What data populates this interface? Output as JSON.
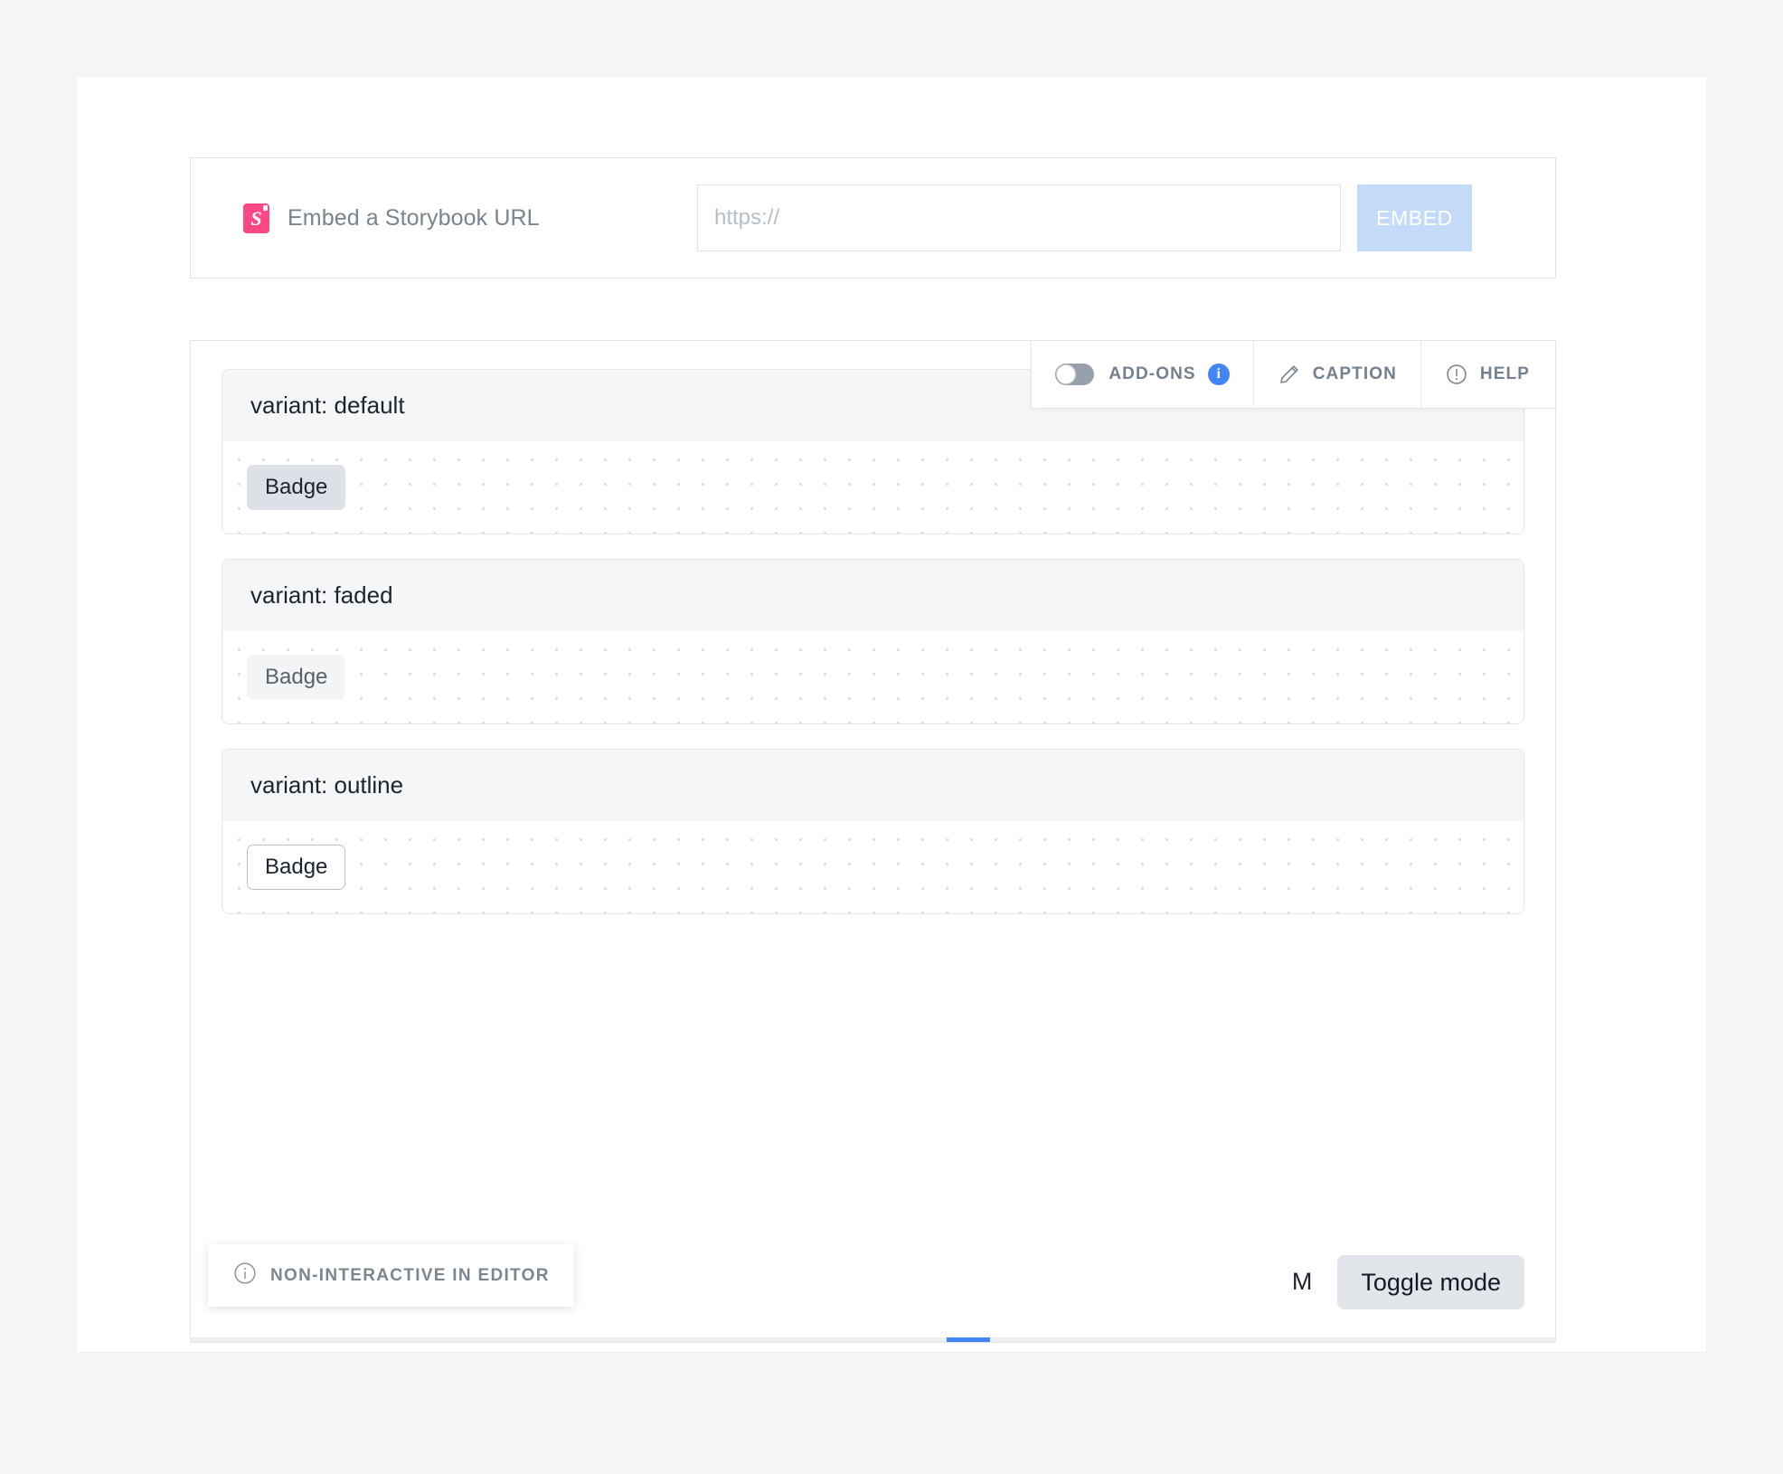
{
  "embed_bar": {
    "logo_icon": "storybook-logo-icon",
    "label": "Embed a Storybook URL",
    "url_value": "",
    "url_placeholder": "https://",
    "embed_button": "EMBED"
  },
  "toolbar": {
    "addons": {
      "label": "ADD-ONS",
      "toggle_state": "off",
      "toggle_icon": "toggle-switch-icon",
      "info_icon": "info-circle-icon",
      "info_color": "#4285f4"
    },
    "caption": {
      "label": "CAPTION",
      "icon": "pencil-icon"
    },
    "help": {
      "label": "HELP",
      "icon": "exclamation-circle-icon"
    }
  },
  "variants": [
    {
      "title": "variant: default",
      "badge_label": "Badge",
      "style": "default"
    },
    {
      "title": "variant: faded",
      "badge_label": "Badge",
      "style": "faded"
    },
    {
      "title": "variant: outline",
      "badge_label": "Badge",
      "style": "outline"
    }
  ],
  "footer": {
    "non_interactive": {
      "label": "NON-INTERACTIVE IN EDITOR",
      "icon": "info-circle-outline-icon"
    },
    "mode_letter": "M",
    "toggle_mode_button": "Toggle mode"
  },
  "colors": {
    "accent_blue": "#4285f4",
    "storybook_pink": "#ff4785",
    "embed_button_bg": "#c3daf9",
    "page_bg": "#f3f5f6"
  }
}
